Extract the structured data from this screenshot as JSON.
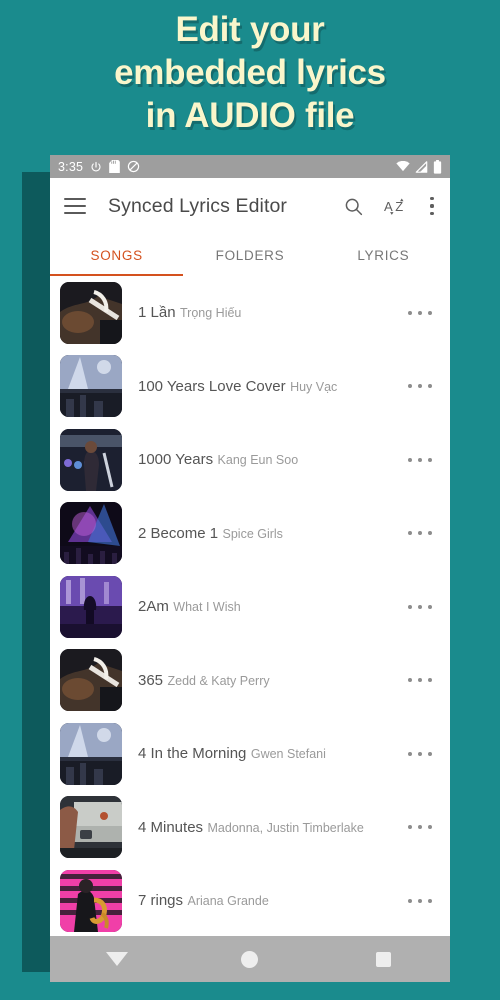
{
  "promo": {
    "headline_lines": [
      "Edit your",
      "embedded lyrics",
      "in AUDIO file"
    ],
    "background_color": "#1a8b8d",
    "headline_color": "#faf6cb"
  },
  "status_bar": {
    "time": "3:35",
    "icons_left": [
      "power-icon",
      "sd-card-icon",
      "do-not-disturb-icon"
    ],
    "icons_right": [
      "wifi-icon",
      "cellular-signal-icon",
      "battery-icon"
    ]
  },
  "app_bar": {
    "menu_icon": "hamburger-menu-icon",
    "title": "Synced Lyrics Editor",
    "actions": [
      {
        "icon": "search-icon",
        "label": "Search"
      },
      {
        "icon": "sort-az-icon",
        "label": "AZ"
      },
      {
        "icon": "overflow-menu-icon",
        "label": "More options"
      }
    ]
  },
  "tabs": {
    "active_index": 0,
    "active_color": "#d4511e",
    "items": [
      {
        "label": "SONGS"
      },
      {
        "label": "FOLDERS"
      },
      {
        "label": "LYRICS"
      }
    ]
  },
  "songs": [
    {
      "title": "1 Lần",
      "artist": "Trọng Hiếu",
      "art": "guitar-player"
    },
    {
      "title": "100 Years Love Cover",
      "artist": "Huy Vạc",
      "art": "concert-stage-lights"
    },
    {
      "title": "1000 Years",
      "artist": "Kang Eun Soo",
      "art": "stage-performer"
    },
    {
      "title": "2 Become 1",
      "artist": "Spice Girls",
      "art": "crowd-purple-lights"
    },
    {
      "title": "2Am",
      "artist": "What I Wish",
      "art": "raised-hand-crowd"
    },
    {
      "title": "365",
      "artist": "Zedd & Katy Perry",
      "art": "guitar-player"
    },
    {
      "title": "4 In the Morning",
      "artist": "Gwen Stefani",
      "art": "concert-stage-lights"
    },
    {
      "title": "4 Minutes",
      "artist": "Madonna, Justin Timberlake",
      "art": "vintage-car"
    },
    {
      "title": "7 rings",
      "artist": "Ariana Grande",
      "art": "pink-zebra-saxophone"
    }
  ],
  "nav_bar": {
    "buttons": [
      {
        "icon": "back-triangle-icon",
        "label": "Back"
      },
      {
        "icon": "home-circle-icon",
        "label": "Home"
      },
      {
        "icon": "recents-square-icon",
        "label": "Recents"
      }
    ]
  }
}
